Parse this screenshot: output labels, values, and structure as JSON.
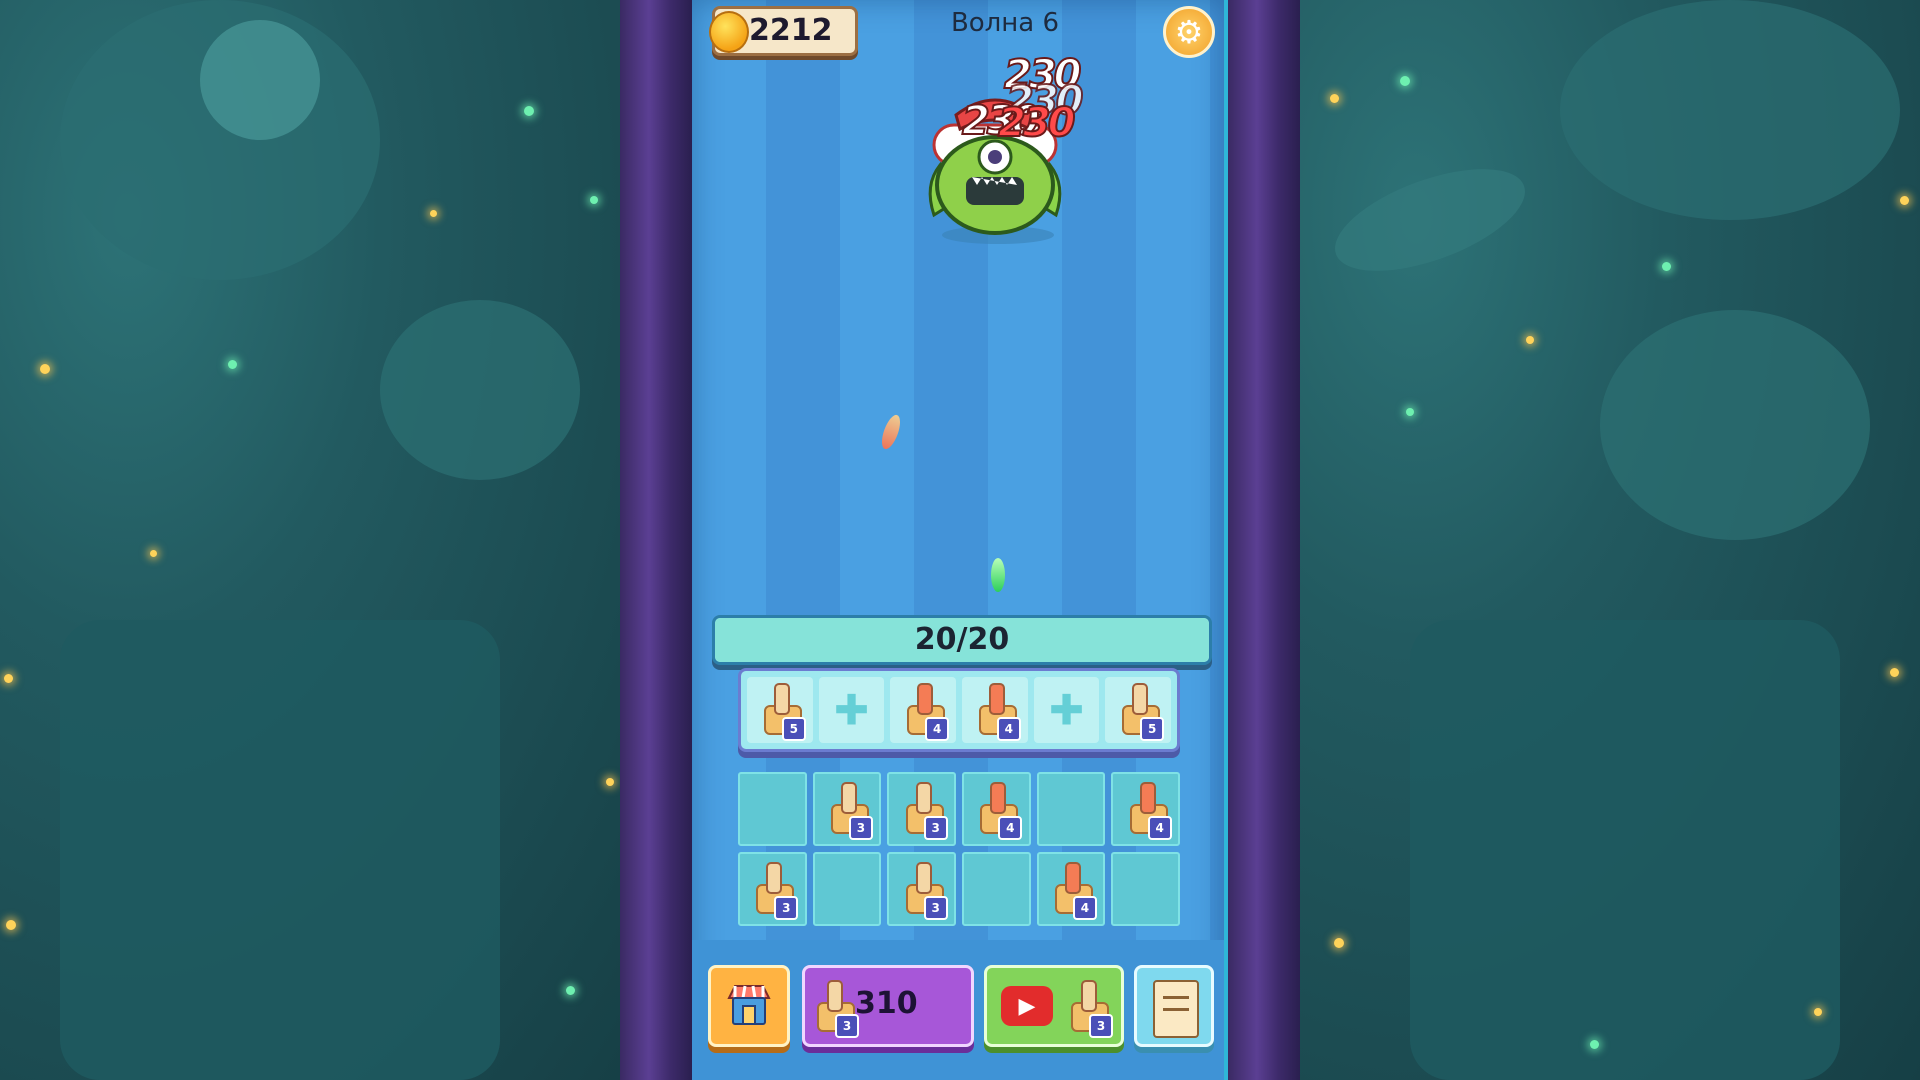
{
  "hud": {
    "coins": "2212",
    "wave_label": "Волна 6",
    "settings_icon": "gear-icon"
  },
  "enemy": {
    "damage_numbers": [
      "230",
      "230",
      "230",
      "230"
    ]
  },
  "base_health": {
    "text": "20/20",
    "current": 20,
    "max": 20
  },
  "deploy_row": [
    {
      "level": "5",
      "empty": false
    },
    {
      "level": "",
      "empty": true
    },
    {
      "level": "4",
      "empty": false
    },
    {
      "level": "4",
      "empty": false
    },
    {
      "level": "",
      "empty": true
    },
    {
      "level": "5",
      "empty": false
    }
  ],
  "merge_grid": [
    {
      "level": "",
      "empty": true
    },
    {
      "level": "3",
      "empty": false
    },
    {
      "level": "3",
      "empty": false
    },
    {
      "level": "4",
      "empty": false
    },
    {
      "level": "",
      "empty": true
    },
    {
      "level": "4",
      "empty": false
    },
    {
      "level": "3",
      "empty": false
    },
    {
      "level": "",
      "empty": true
    },
    {
      "level": "3",
      "empty": false
    },
    {
      "level": "",
      "empty": true
    },
    {
      "level": "4",
      "empty": false
    },
    {
      "level": "",
      "empty": true
    }
  ],
  "bottom_bar": {
    "shop_icon": "shop-icon",
    "buy_price": "310",
    "buy_level": "3",
    "ad_level": "3",
    "tasks_icon": "scroll-icon"
  },
  "colors": {
    "field": "#4aa0e2",
    "frame": "#5b3f93",
    "coin": "#f5a316",
    "buy_button": "#a757d8",
    "ad_button": "#83d45a",
    "shop_button": "#ffb342"
  }
}
